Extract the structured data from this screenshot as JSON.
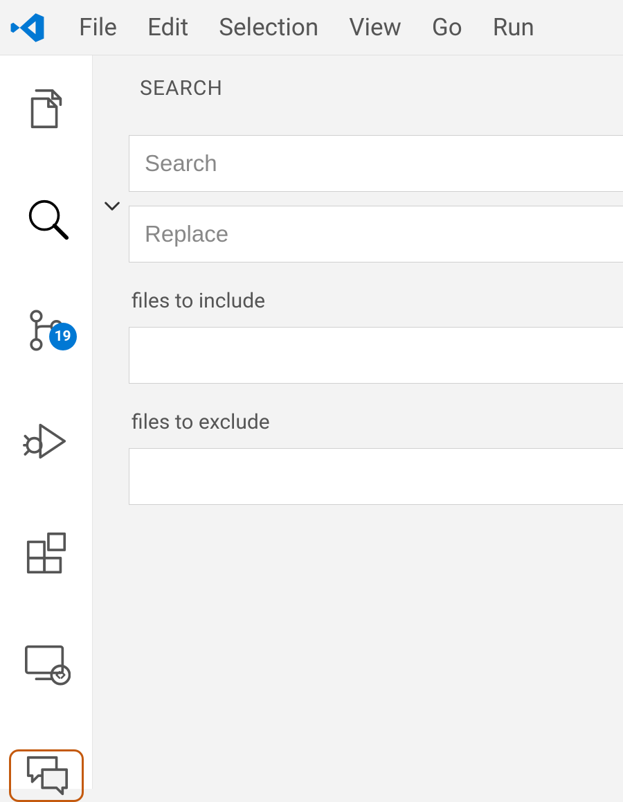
{
  "menubar": {
    "items": [
      "File",
      "Edit",
      "Selection",
      "View",
      "Go",
      "Run"
    ]
  },
  "activityBar": {
    "explorer": {
      "name": "explorer"
    },
    "search": {
      "name": "search"
    },
    "sourceControl": {
      "name": "source-control",
      "badge": "19"
    },
    "runDebug": {
      "name": "run-and-debug"
    },
    "extensions": {
      "name": "extensions"
    },
    "remote": {
      "name": "remote-explorer"
    },
    "chat": {
      "name": "github-copilot-chat"
    }
  },
  "searchPanel": {
    "title": "SEARCH",
    "searchPlaceholder": "Search",
    "replacePlaceholder": "Replace",
    "includeLabel": "files to include",
    "excludeLabel": "files to exclude",
    "searchValue": "",
    "replaceValue": "",
    "includeValue": "",
    "excludeValue": ""
  }
}
